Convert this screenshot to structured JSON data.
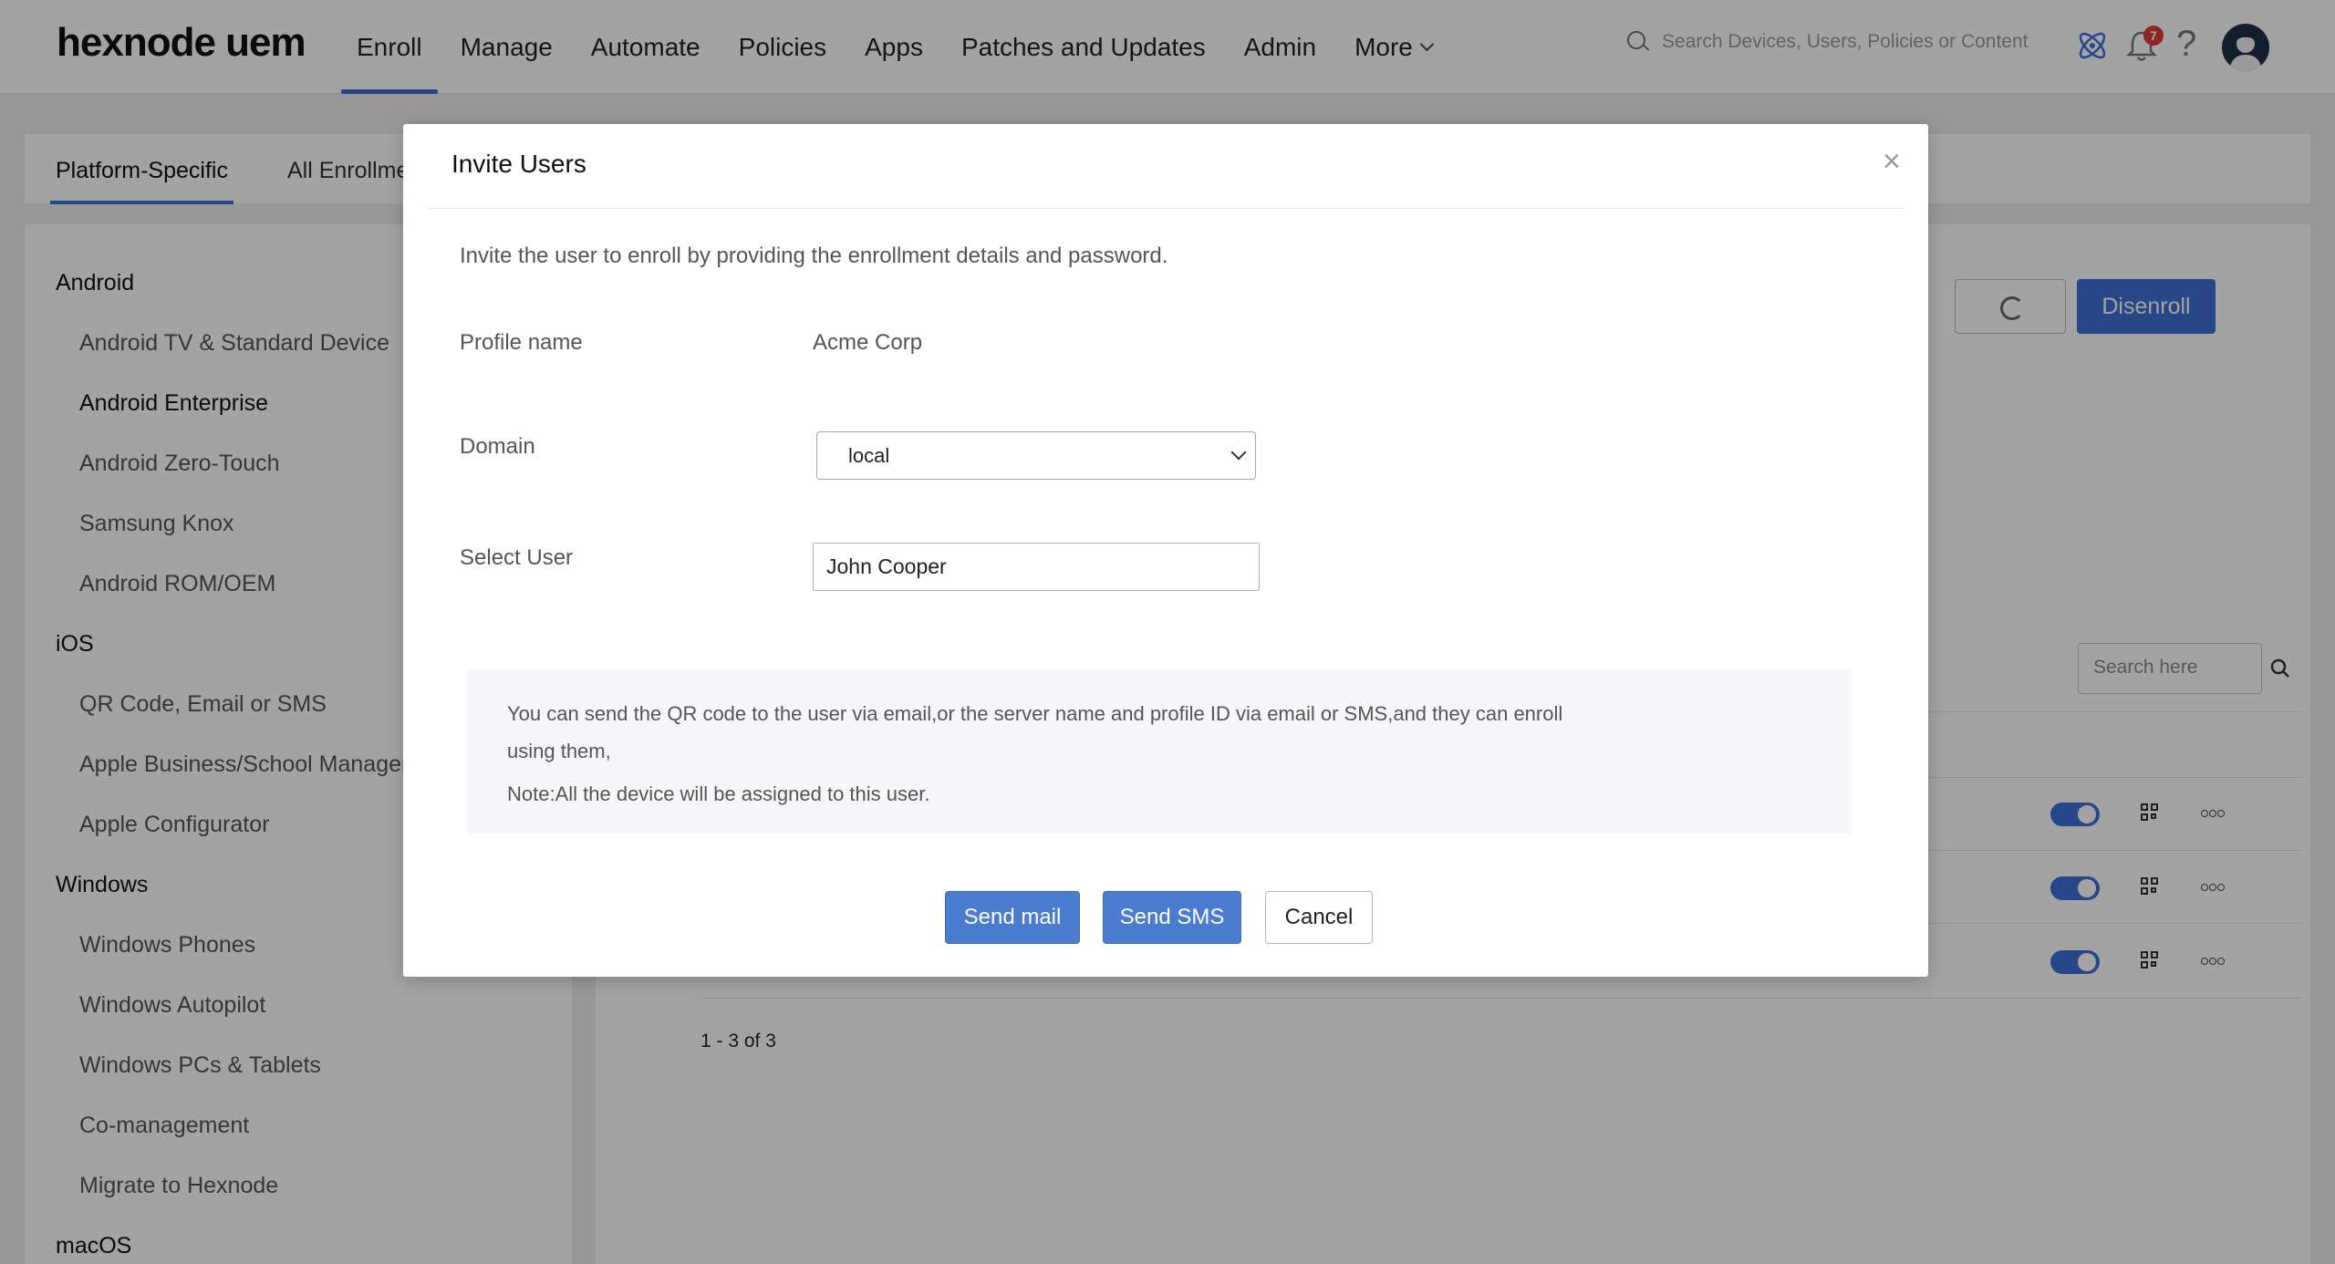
{
  "header": {
    "logo": "hexnode uem",
    "nav": [
      "Enroll",
      "Manage",
      "Automate",
      "Policies",
      "Apps",
      "Patches and Updates",
      "Admin"
    ],
    "more_label": "More",
    "search_placeholder": "Search Devices, Users, Policies or Content",
    "notifications_count": "7",
    "help_label": "?"
  },
  "page": {
    "tabs": [
      "Platform-Specific",
      "All Enrollme"
    ],
    "sidebar": [
      {
        "label": "Android",
        "type": "group"
      },
      {
        "label": "Android TV & Standard Device",
        "type": "item"
      },
      {
        "label": "Android Enterprise",
        "type": "item-active"
      },
      {
        "label": "Android Zero-Touch",
        "type": "item"
      },
      {
        "label": "Samsung Knox",
        "type": "item"
      },
      {
        "label": "Android ROM/OEM",
        "type": "item"
      },
      {
        "label": "iOS",
        "type": "group"
      },
      {
        "label": "QR Code, Email or SMS",
        "type": "item"
      },
      {
        "label": "Apple Business/School Manager",
        "type": "item"
      },
      {
        "label": "Apple Configurator",
        "type": "item"
      },
      {
        "label": "Windows",
        "type": "group"
      },
      {
        "label": "Windows Phones",
        "type": "item"
      },
      {
        "label": "Windows Autopilot",
        "type": "item"
      },
      {
        "label": "Windows PCs & Tablets",
        "type": "item"
      },
      {
        "label": "Co-management",
        "type": "item"
      },
      {
        "label": "Migrate to Hexnode",
        "type": "item"
      },
      {
        "label": "macOS",
        "type": "group"
      }
    ],
    "disenroll_label": "Disenroll",
    "search_placeholder": "Search here",
    "pagination": "1 - 3 of 3"
  },
  "modal": {
    "title": "Invite Users",
    "close": "×",
    "intro": "Invite the user to enroll by providing the enrollment details and password.",
    "profile_label": "Profile name",
    "profile_value": "Acme Corp",
    "domain_label": "Domain",
    "domain_value": "local",
    "user_label": "Select User",
    "user_value": "John Cooper",
    "info_text": "You can send the QR code to the user via email,or the server name and profile ID via email or SMS,and they can enroll using them,",
    "info_note": "Note:All the device will be assigned to this user.",
    "send_mail": "Send mail",
    "send_sms": "Send SMS",
    "cancel": "Cancel"
  },
  "colors": {
    "accent": "#3f6fd6",
    "primary_button": "#4a7dcf",
    "badge": "#e23b3b"
  }
}
